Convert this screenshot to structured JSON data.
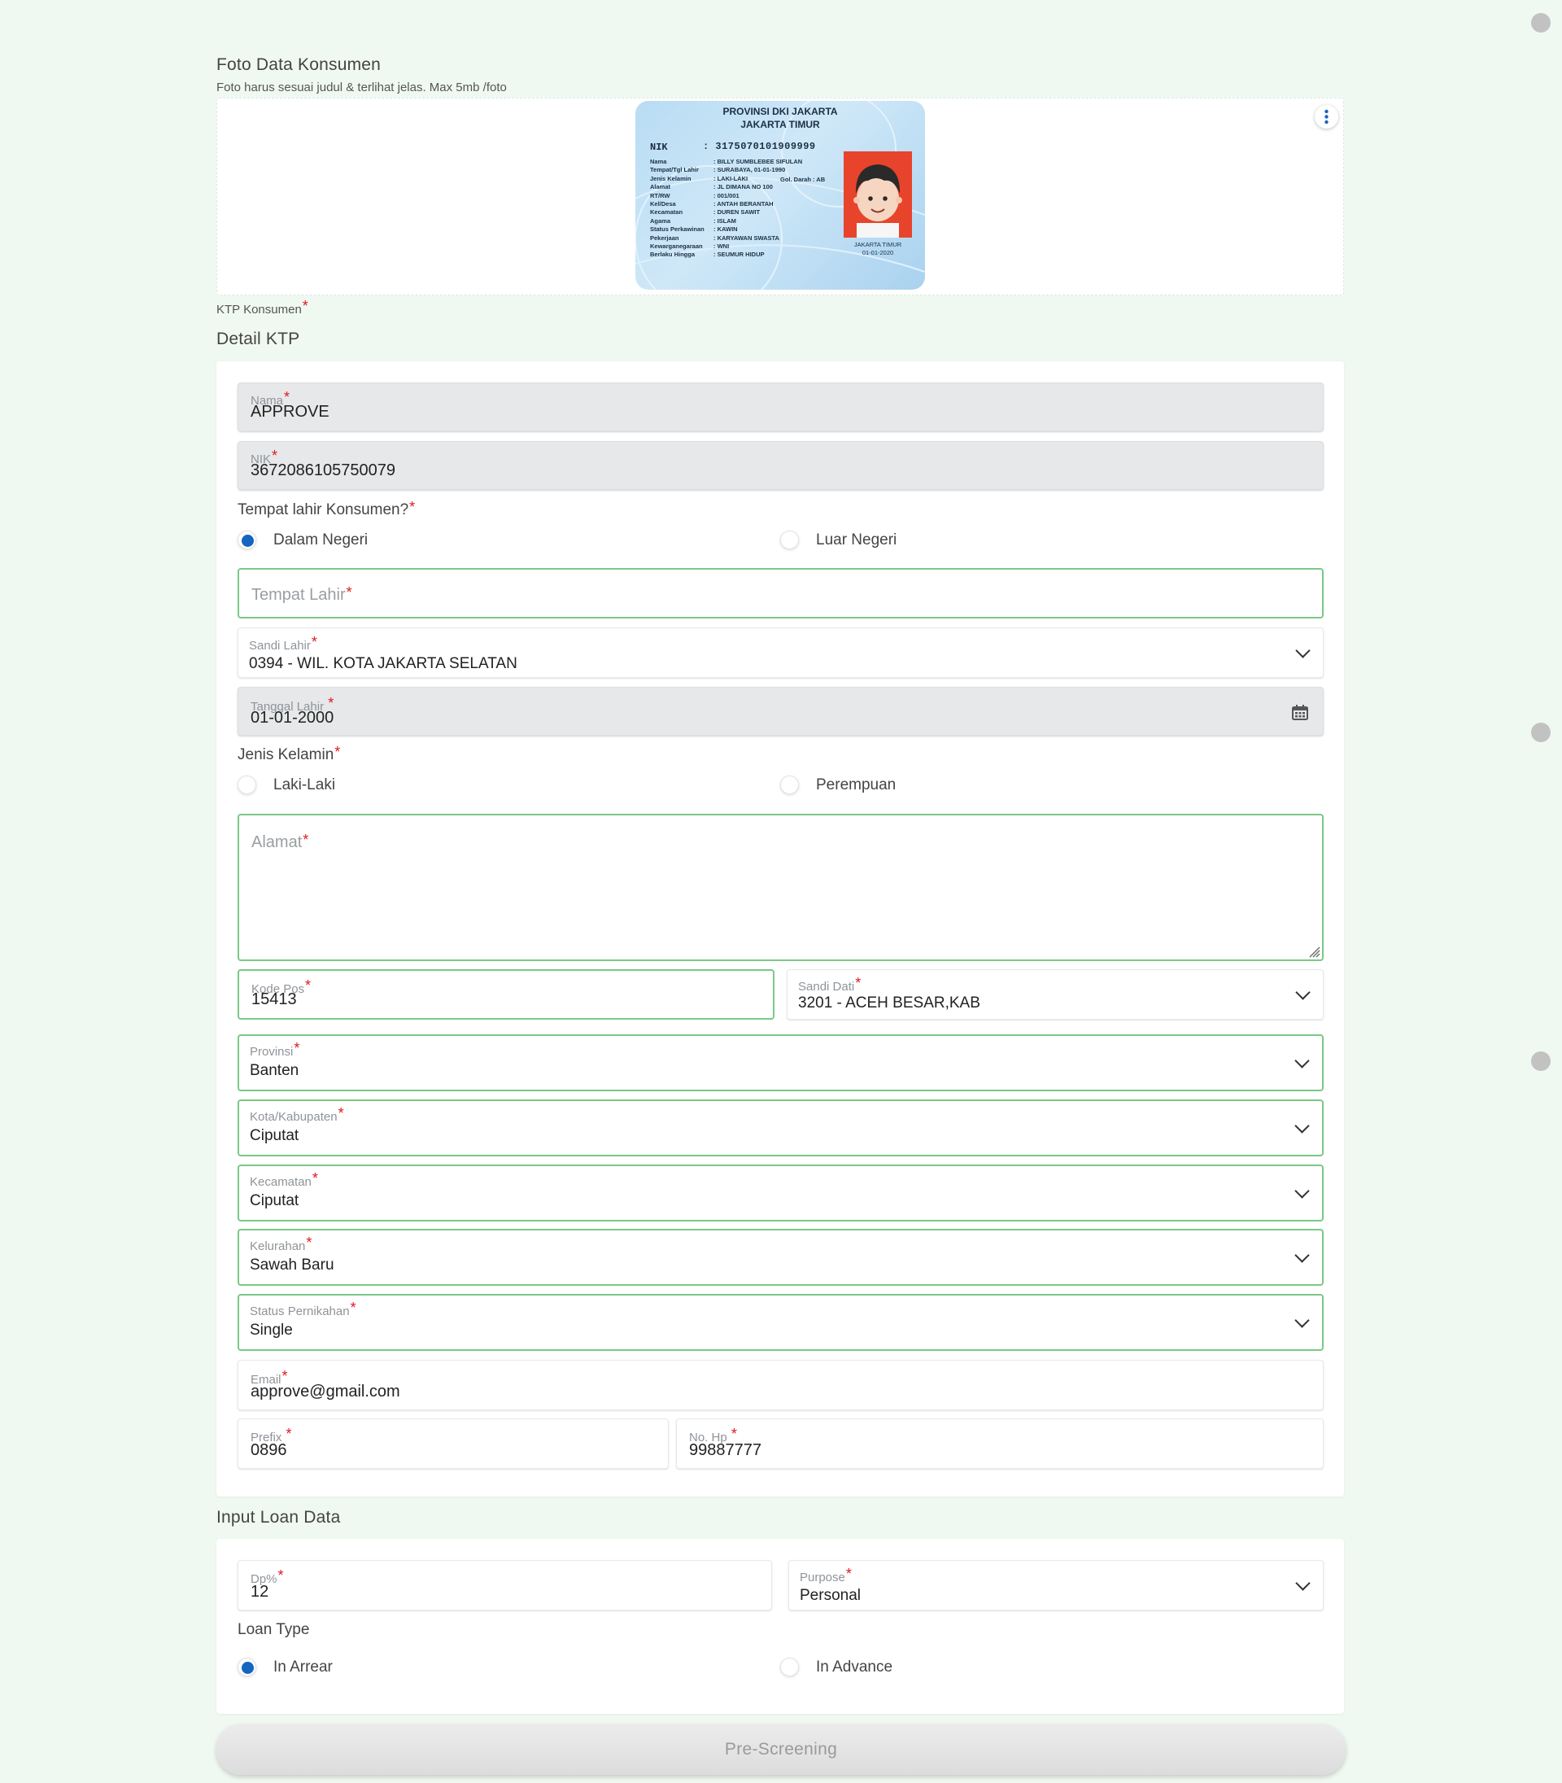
{
  "photo_section": {
    "title": "Foto Data Konsumen",
    "subtitle": "Foto harus sesuai judul & terlihat jelas. Max 5mb /foto",
    "caption": "KTP Konsumen",
    "menu_icon": "more-vertical-icon",
    "ktp_card": {
      "header_line1": "PROVINSI DKI JAKARTA",
      "header_line2": "JAKARTA TIMUR",
      "nik_label": "NIK",
      "nik_value": ": 3175070101909999",
      "rows": [
        {
          "label": "Nama",
          "value": ": BILLY SUMBLEBEE SIFULAN"
        },
        {
          "label": "Tempat/Tgl Lahir",
          "value": ": SURABAYA, 01-01-1990"
        },
        {
          "label": "Jenis Kelamin",
          "value": ": LAKI-LAKI"
        },
        {
          "label": "Alamat",
          "value": ": JL DIMANA NO 100"
        },
        {
          "label": "RT/RW",
          "value": ": 001/001"
        },
        {
          "label": "Kel/Desa",
          "value": ": ANTAH BERANTAH"
        },
        {
          "label": "Kecamatan",
          "value": ": DUREN SAWIT"
        },
        {
          "label": "Agama",
          "value": ": ISLAM"
        },
        {
          "label": "Status Perkawinan",
          "value": ": KAWIN"
        },
        {
          "label": "Pekerjaan",
          "value": ": KARYAWAN SWASTA"
        },
        {
          "label": "Kewarganegaraan",
          "value": ": WNI"
        },
        {
          "label": "Berlaku Hingga",
          "value": ": SEUMUR HIDUP"
        }
      ],
      "gol_darah": "Gol. Darah : AB",
      "issue_place": "JAKARTA TIMUR",
      "issue_date": "01-01-2020"
    }
  },
  "detail_ktp": {
    "title": "Detail KTP",
    "nama": {
      "label": "Nama",
      "value": "APPROVE"
    },
    "nik": {
      "label": "NIK",
      "value": "3672086105750079"
    },
    "birthplace_question": "Tempat lahir Konsumen?",
    "birthplace_options": [
      "Dalam Negeri",
      "Luar Negeri"
    ],
    "birthplace_selected": "Dalam Negeri",
    "tempat_lahir": {
      "placeholder": "Tempat Lahir",
      "value": ""
    },
    "sandi_lahir": {
      "label": "Sandi Lahir",
      "value": "0394 - WIL. KOTA JAKARTA SELATAN"
    },
    "tanggal_lahir": {
      "label": "Tanggal Lahir ",
      "value": "01-01-2000",
      "icon": "calendar-icon"
    },
    "gender_question": "Jenis Kelamin",
    "gender_options": [
      "Laki-Laki",
      "Perempuan"
    ],
    "gender_selected": "",
    "alamat": {
      "placeholder": "Alamat",
      "value": ""
    },
    "kode_pos": {
      "label": "Kode Pos",
      "value": "15413"
    },
    "sandi_dati": {
      "label": "Sandi Dati",
      "value": "3201 - ACEH BESAR,KAB"
    },
    "provinsi": {
      "label": "Provinsi",
      "value": "Banten"
    },
    "kota": {
      "label": "Kota/Kabupaten",
      "value": "Ciputat"
    },
    "kecamatan": {
      "label": "Kecamatan",
      "value": "Ciputat"
    },
    "kelurahan": {
      "label": "Kelurahan",
      "value": "Sawah Baru"
    },
    "status_pernikahan": {
      "label": "Status Pernikahan",
      "value": "Single"
    },
    "email": {
      "label": "Email",
      "value": "approve@gmail.com"
    },
    "prefix": {
      "label": "Prefix ",
      "value": "0896"
    },
    "no_hp": {
      "label": "No. Hp ",
      "value": "99887777"
    }
  },
  "loan": {
    "title": "Input Loan Data",
    "dp": {
      "label": "Dp%",
      "value": "12"
    },
    "purpose": {
      "label": "Purpose",
      "value": "Personal"
    },
    "loan_type_label": "Loan Type",
    "loan_type_options": [
      "In Arrear",
      "In Advance"
    ],
    "loan_type_selected": "In Arrear"
  },
  "submit": {
    "label": "Pre-Screening"
  },
  "required_mark": "*",
  "colors": {
    "background": "#f0f9f1",
    "accent_green_border": "#7bc887",
    "radio_selected": "#1565c0",
    "required": "#e0191c",
    "disabled_field": "#e6e8ea"
  }
}
